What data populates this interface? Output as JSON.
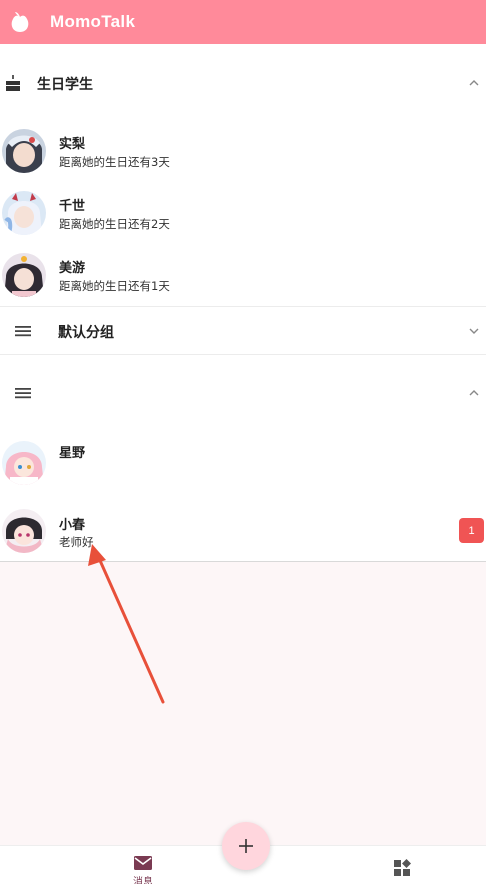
{
  "app": {
    "title": "MomoTalk"
  },
  "birthday_section": {
    "title": "生日学生",
    "students": [
      {
        "name": "实梨",
        "subtitle": "距离她的生日还有3天"
      },
      {
        "name": "千世",
        "subtitle": "距离她的生日还有2天"
      },
      {
        "name": "美游",
        "subtitle": "距离她的生日还有1天"
      }
    ]
  },
  "default_group": {
    "title": "默认分组"
  },
  "unnamed_group": {
    "title": "",
    "chats": [
      {
        "name": "星野",
        "last_message": ""
      },
      {
        "name": "小春",
        "last_message": "老师好",
        "unread": "1"
      }
    ]
  },
  "bottom_nav": {
    "messages_label": "消息"
  },
  "colors": {
    "appbar": "#ff8a9a",
    "badge": "#f05454",
    "background": "#fdf6f7",
    "fab": "#ffd6dd",
    "annotation_arrow": "#e8503a"
  },
  "icons": {
    "logo": "peach-logo-icon",
    "birthday": "cake-icon",
    "group": "menu-icon",
    "expand": "chevron-up-icon",
    "collapse": "chevron-down-icon",
    "messages": "mail-icon",
    "apps": "widgets-icon",
    "add": "plus-icon"
  }
}
